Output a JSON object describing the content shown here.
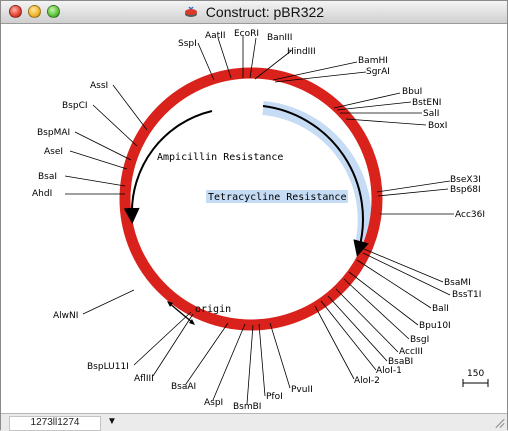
{
  "window": {
    "title": "Construct:  pBR322"
  },
  "colors": {
    "ring": "#d9221c",
    "feature_highlight": "#c6dcf5",
    "leader_line": "#000000"
  },
  "features": {
    "ampicillin": "Ampicillin Resistance",
    "tetracycline": "Tetracycline Resistance",
    "origin": "origin"
  },
  "sites_top": [
    "SspI",
    "AatII",
    "EcoRI",
    "BanIII",
    "HindIII"
  ],
  "sites_right": [
    "BamHI",
    "SgrAI",
    "BbuI",
    "BstENI",
    "SalI",
    "BoxI",
    "BseX3I",
    "Bsp68I",
    "Acc36I",
    "BsaMI",
    "BssT1I",
    "BalI",
    "Bpu10I",
    "BsgI",
    "AccIII",
    "BsaBI",
    "AloI-1",
    "AloI-2"
  ],
  "sites_bottom": [
    "PvuII",
    "PfoI",
    "BsmBI",
    "AspI",
    "BsaAI",
    "AflIII",
    "BspLU11I"
  ],
  "sites_left": [
    "AlwNI",
    "AhdI",
    "BsaI",
    "AseI",
    "BspMAI",
    "BspCI",
    "AssI"
  ],
  "scale_bar": {
    "label": "150"
  },
  "status": {
    "coordinates": "1273ll1274"
  }
}
